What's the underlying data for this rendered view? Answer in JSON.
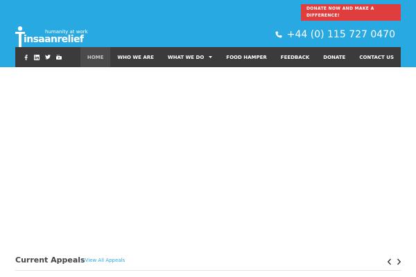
{
  "header": {
    "donate_button": "DONATE NOW AND MAKE A DIFFERENCE!",
    "logo_tagline": "humanity at work",
    "logo_brand": "insaanrelief",
    "phone": "+44 (0) 115 727 0470",
    "colors": {
      "header_bg": "#29a9e1",
      "donate_bg": "#e03e3e",
      "nav_bg": "#3b3b3b"
    }
  },
  "navbar": {
    "social_icons": [
      "facebook-icon",
      "linkedin-icon",
      "twitter-icon",
      "youtube-icon"
    ],
    "items": [
      {
        "label": "HOME"
      },
      {
        "label": "WHO WE ARE"
      },
      {
        "label": "WHAT WE DO"
      },
      {
        "label": "FOOD HAMPER"
      },
      {
        "label": "FEEDBACK"
      },
      {
        "label": "DONATE"
      },
      {
        "label": "CONTACT US"
      }
    ]
  },
  "appeals": {
    "title": "Current Appeals",
    "view_all": "/ View All Appeals"
  }
}
